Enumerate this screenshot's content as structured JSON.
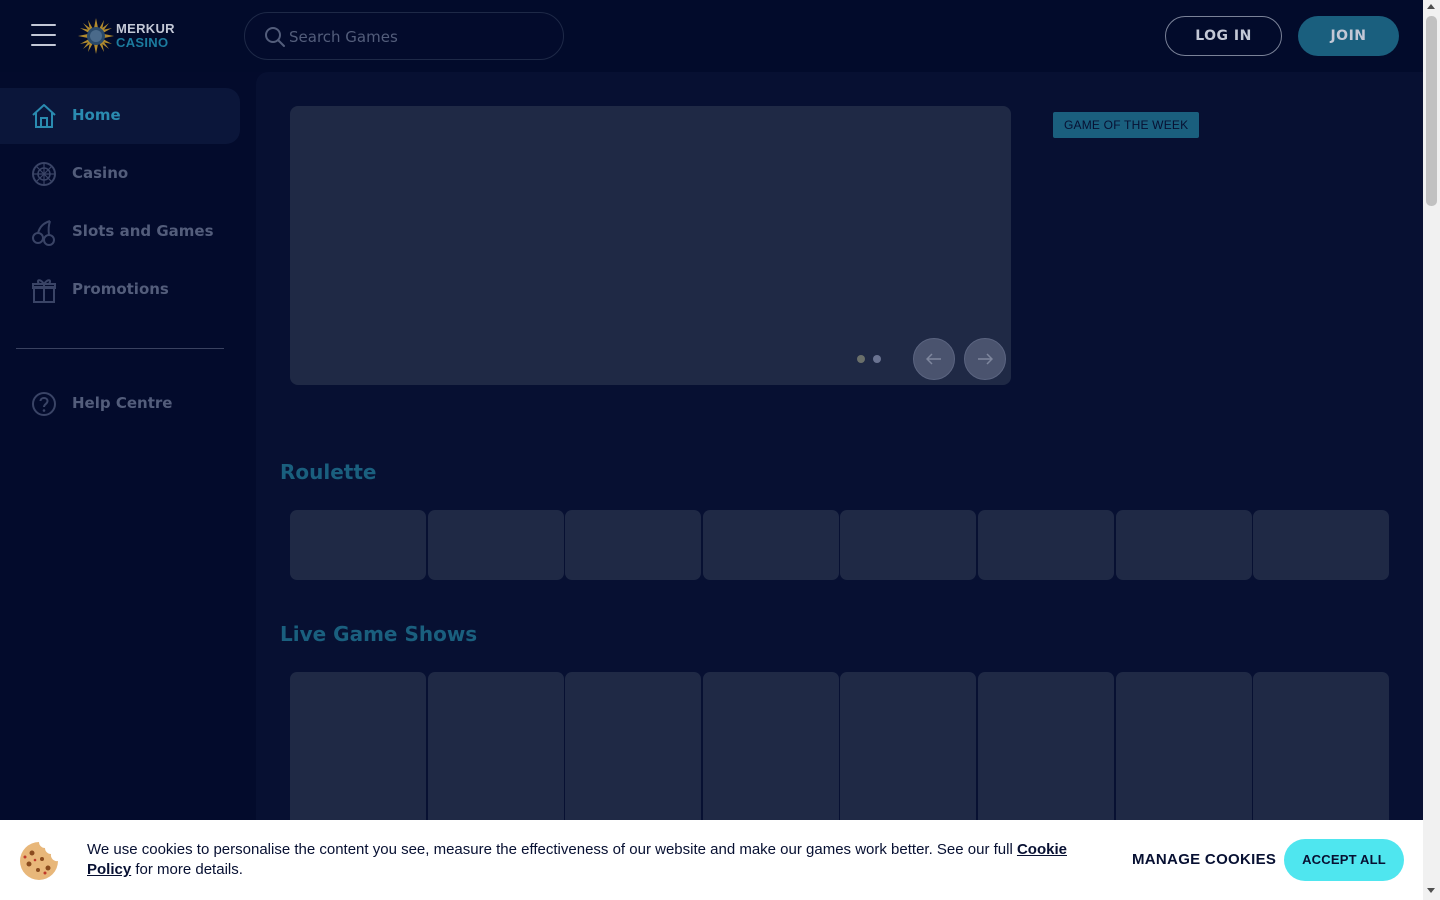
{
  "header": {
    "logo": {
      "line1": "MERKUR",
      "line2": "CASINO"
    },
    "search": {
      "placeholder": "Search Games"
    },
    "login_label": "LOG IN",
    "join_label": "JOIN"
  },
  "sidebar": {
    "items": [
      {
        "label": "Home",
        "icon": "home-icon",
        "active": true
      },
      {
        "label": "Casino",
        "icon": "roulette-wheel-icon",
        "active": false
      },
      {
        "label": "Slots and Games",
        "icon": "cherries-icon",
        "active": false
      },
      {
        "label": "Promotions",
        "icon": "gift-icon",
        "active": false
      }
    ],
    "help": {
      "label": "Help Centre",
      "icon": "help-circle-icon"
    }
  },
  "main": {
    "carousel": {
      "slides": 2,
      "active_slide": 1,
      "prev_icon": "arrow-left-icon",
      "next_icon": "arrow-right-icon"
    },
    "game_of_week_label": "GAME OF THE WEEK",
    "sections": [
      {
        "title": "Roulette",
        "tiles": 8
      },
      {
        "title": "Live Game Shows",
        "tiles": 8
      }
    ]
  },
  "cookie_banner": {
    "text_before": "We use cookies to personalise the content you see, measure the effectiveness of our website and make our games work better. See our full ",
    "link_text": "Cookie Policy",
    "text_after": " for more details.",
    "manage_label": "MANAGE COOKIES",
    "accept_label": "ACCEPT ALL"
  },
  "colors": {
    "background": "#030b2c",
    "main_panel": "#071032",
    "placeholder_tile": "#1f2945",
    "accent_teal": "#1a5f7e",
    "accept_button": "#4fe6ef"
  }
}
